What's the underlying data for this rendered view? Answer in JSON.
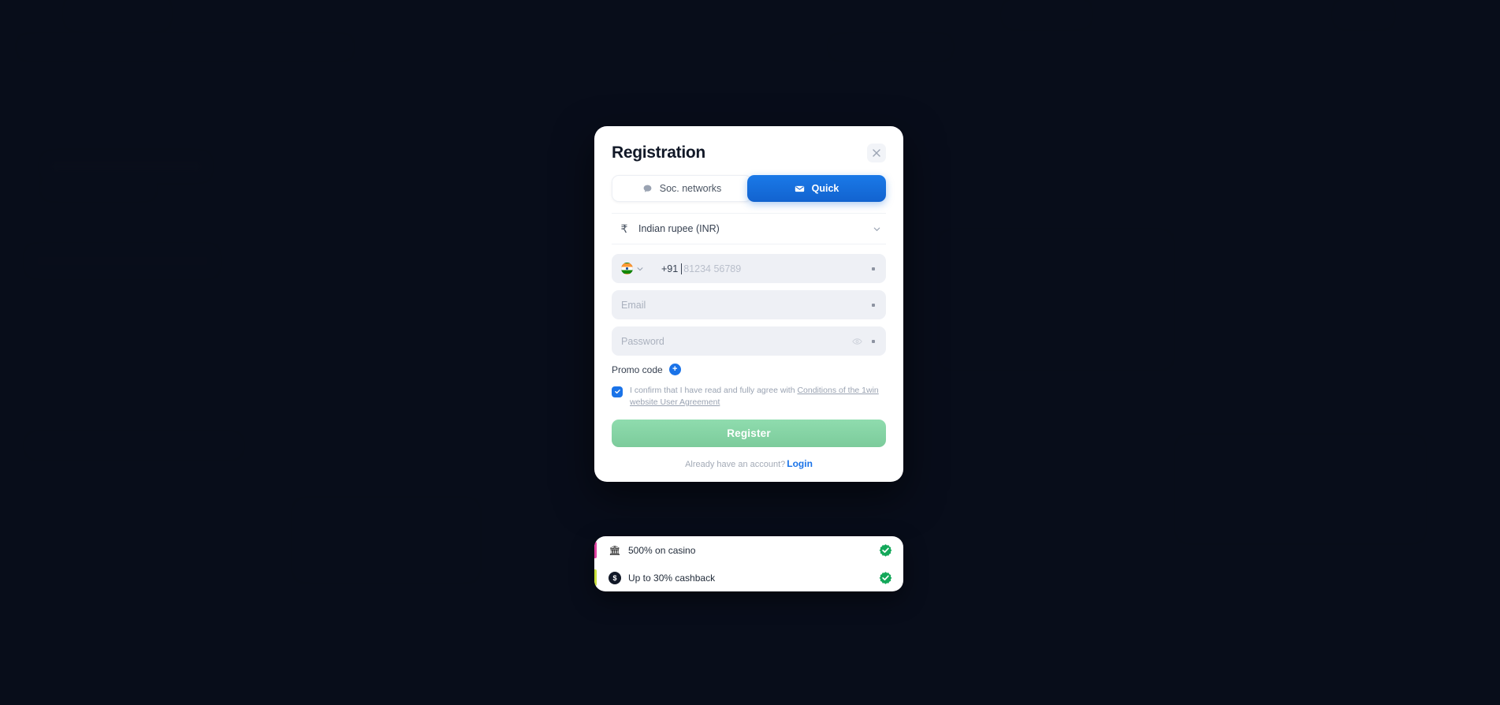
{
  "modal": {
    "title": "Registration",
    "close_label": "×",
    "close_icon": "close-icon",
    "tabs": [
      {
        "label": "Soc. networks",
        "icon": "chat-bubble-icon",
        "active": false
      },
      {
        "label": "Quick",
        "icon": "envelope-icon",
        "active": true
      }
    ],
    "currency": {
      "symbol": "₹",
      "label": "Indian rupee (INR)",
      "chevron_icon": "chevron-down-icon"
    },
    "phone": {
      "flag_icon": "india-flag-icon",
      "chevron_icon": "chevron-down-icon",
      "dial_code": "+91",
      "placeholder": "81234 56789",
      "value": "",
      "required_marker": "*"
    },
    "email": {
      "placeholder": "Email",
      "value": "",
      "required_marker": "*"
    },
    "password": {
      "placeholder": "Password",
      "value": "",
      "eye_icon": "eye-icon",
      "required_marker": "*"
    },
    "promo": {
      "label": "Promo code",
      "plus_icon": "plus-circle-icon",
      "plus_glyph": "+"
    },
    "agreement": {
      "checked": true,
      "check_icon": "checkmark-icon",
      "text_before": "I confirm that I have read and fully agree with ",
      "link_text": "Conditions of the 1win website User Agreement"
    },
    "register_button": "Register",
    "login_prompt": "Already have an account?",
    "login_link": "Login"
  },
  "bonus": {
    "items": [
      {
        "label": "500% on casino",
        "icon": "casino-bank-icon",
        "glyph": "🏛",
        "bar_color": "#e040a0",
        "badge_icon": "verified-check-icon"
      },
      {
        "label": "Up to 30% cashback",
        "icon": "cashback-coin-icon",
        "glyph": "$",
        "bar_color": "#c8e03a",
        "badge_icon": "verified-check-icon"
      }
    ]
  },
  "colors": {
    "accent_blue": "#1a73e8",
    "register_green": "#7ccb9b",
    "badge_green": "#1faa5c",
    "overlay": "#0a0f1c"
  }
}
